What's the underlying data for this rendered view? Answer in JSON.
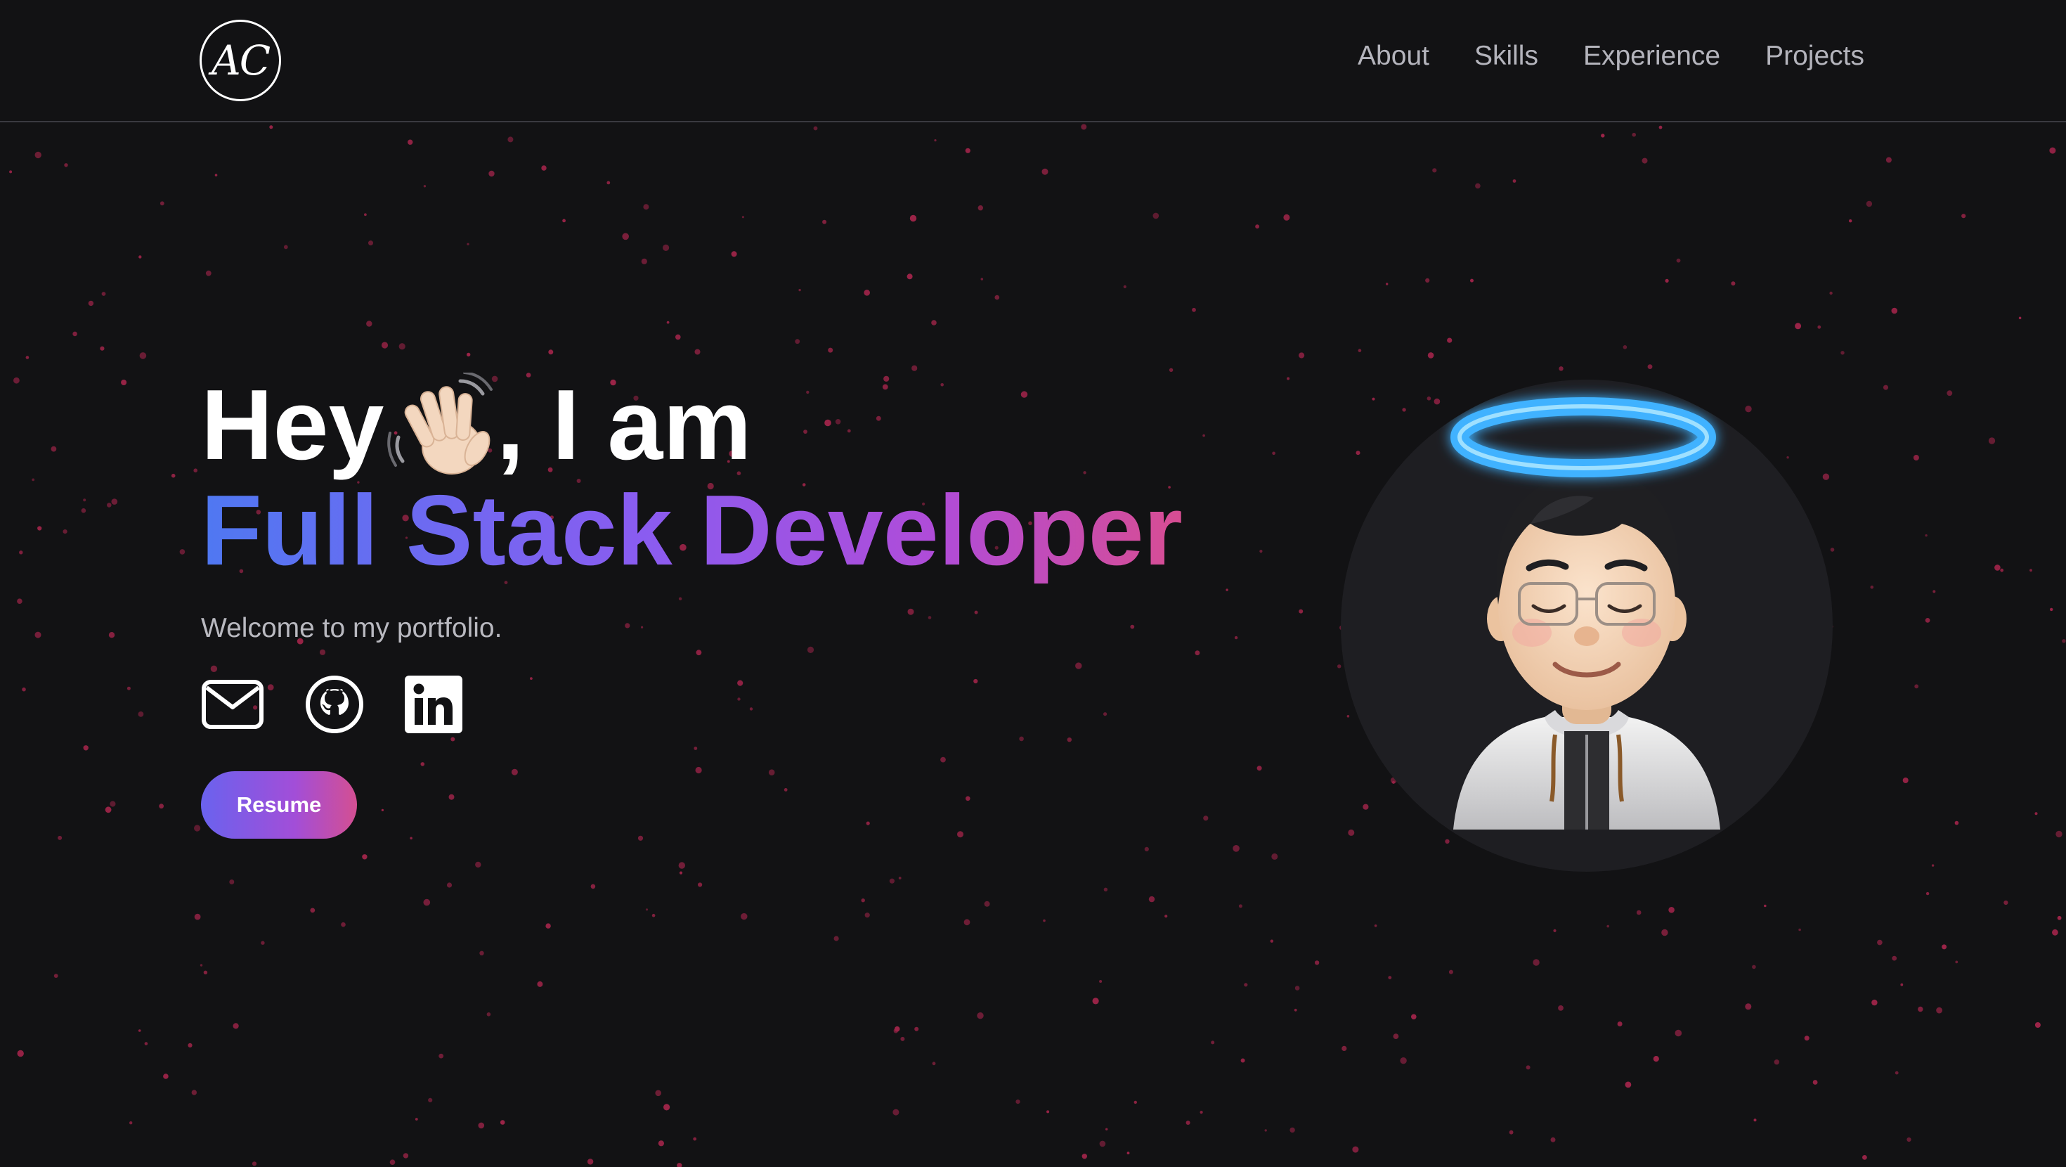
{
  "header": {
    "logo_text": "AC",
    "nav": [
      {
        "label": "About"
      },
      {
        "label": "Skills"
      },
      {
        "label": "Experience"
      },
      {
        "label": "Projects"
      }
    ]
  },
  "hero": {
    "greeting_prefix": "Hey",
    "greeting_suffix": ", I am",
    "role": "Full Stack Developer",
    "welcome": "Welcome to my portfolio.",
    "socials": [
      {
        "icon": "mail-icon"
      },
      {
        "icon": "github-icon"
      },
      {
        "icon": "linkedin-icon"
      }
    ],
    "resume_label": "Resume"
  },
  "colors": {
    "background": "#121214",
    "particle": "#9c2448",
    "nav_text": "#b4b4bc",
    "gradient_start": "#4f78f2",
    "gradient_mid": "#8a5cf0",
    "gradient_end": "#d84d92",
    "halo": "#3fb2ff"
  }
}
